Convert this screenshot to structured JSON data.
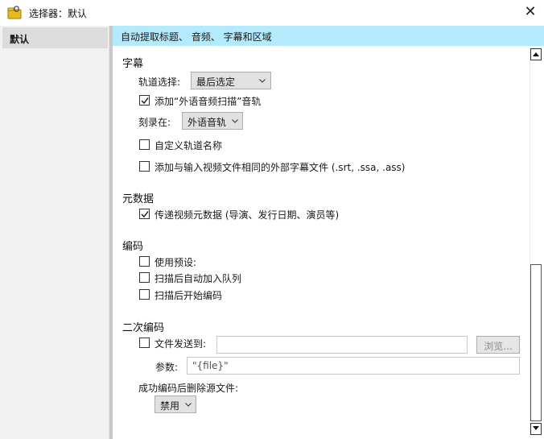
{
  "window": {
    "title": "选择器：默认",
    "icon": "folder-lock-icon",
    "close": "✕"
  },
  "sidebar": {
    "items": [
      {
        "label": "默认",
        "selected": true
      }
    ]
  },
  "banner": {
    "text": "自动提取标题、 音频、 字幕和区域"
  },
  "subtitle_section": {
    "title": "字幕",
    "track_select_label": "轨道选择:",
    "track_select_value": "最后选定",
    "add_foreign_audio_scan": {
      "label": "添加“外语音频扫描”音轨",
      "checked": true
    },
    "burn_in_label": "刻录在:",
    "burn_in_value": "外语音轨",
    "custom_track_name": {
      "label": "自定义轨道名称",
      "checked": false
    },
    "add_external_subs": {
      "label": "添加与输入视频文件相同的外部字幕文件 (.srt, .ssa, .ass)",
      "checked": false
    }
  },
  "metadata_section": {
    "title": "元数据",
    "pass_through": {
      "label": "传递视频元数据 (导演、发行日期、演员等)",
      "checked": true
    }
  },
  "encoding_section": {
    "title": "编码",
    "use_preset": {
      "label": "使用预设:",
      "checked": false
    },
    "auto_queue": {
      "label": "扫描后自动加入队列",
      "checked": false
    },
    "start_encode": {
      "label": "扫描后开始编码",
      "checked": false
    }
  },
  "post_encode_section": {
    "title": "二次编码",
    "send_file_to": {
      "label": "文件发送到:",
      "checked": false,
      "value": ""
    },
    "browse_label": "浏览...",
    "args_label": "参数:",
    "args_value": "\"{file}\"",
    "delete_source_label": "成功编码后删除源文件:",
    "delete_source_value": "禁用"
  },
  "colors": {
    "banner": "#b3eafc",
    "sidebar": "#f2f2f2",
    "selected_item": "#dcdcdc"
  }
}
